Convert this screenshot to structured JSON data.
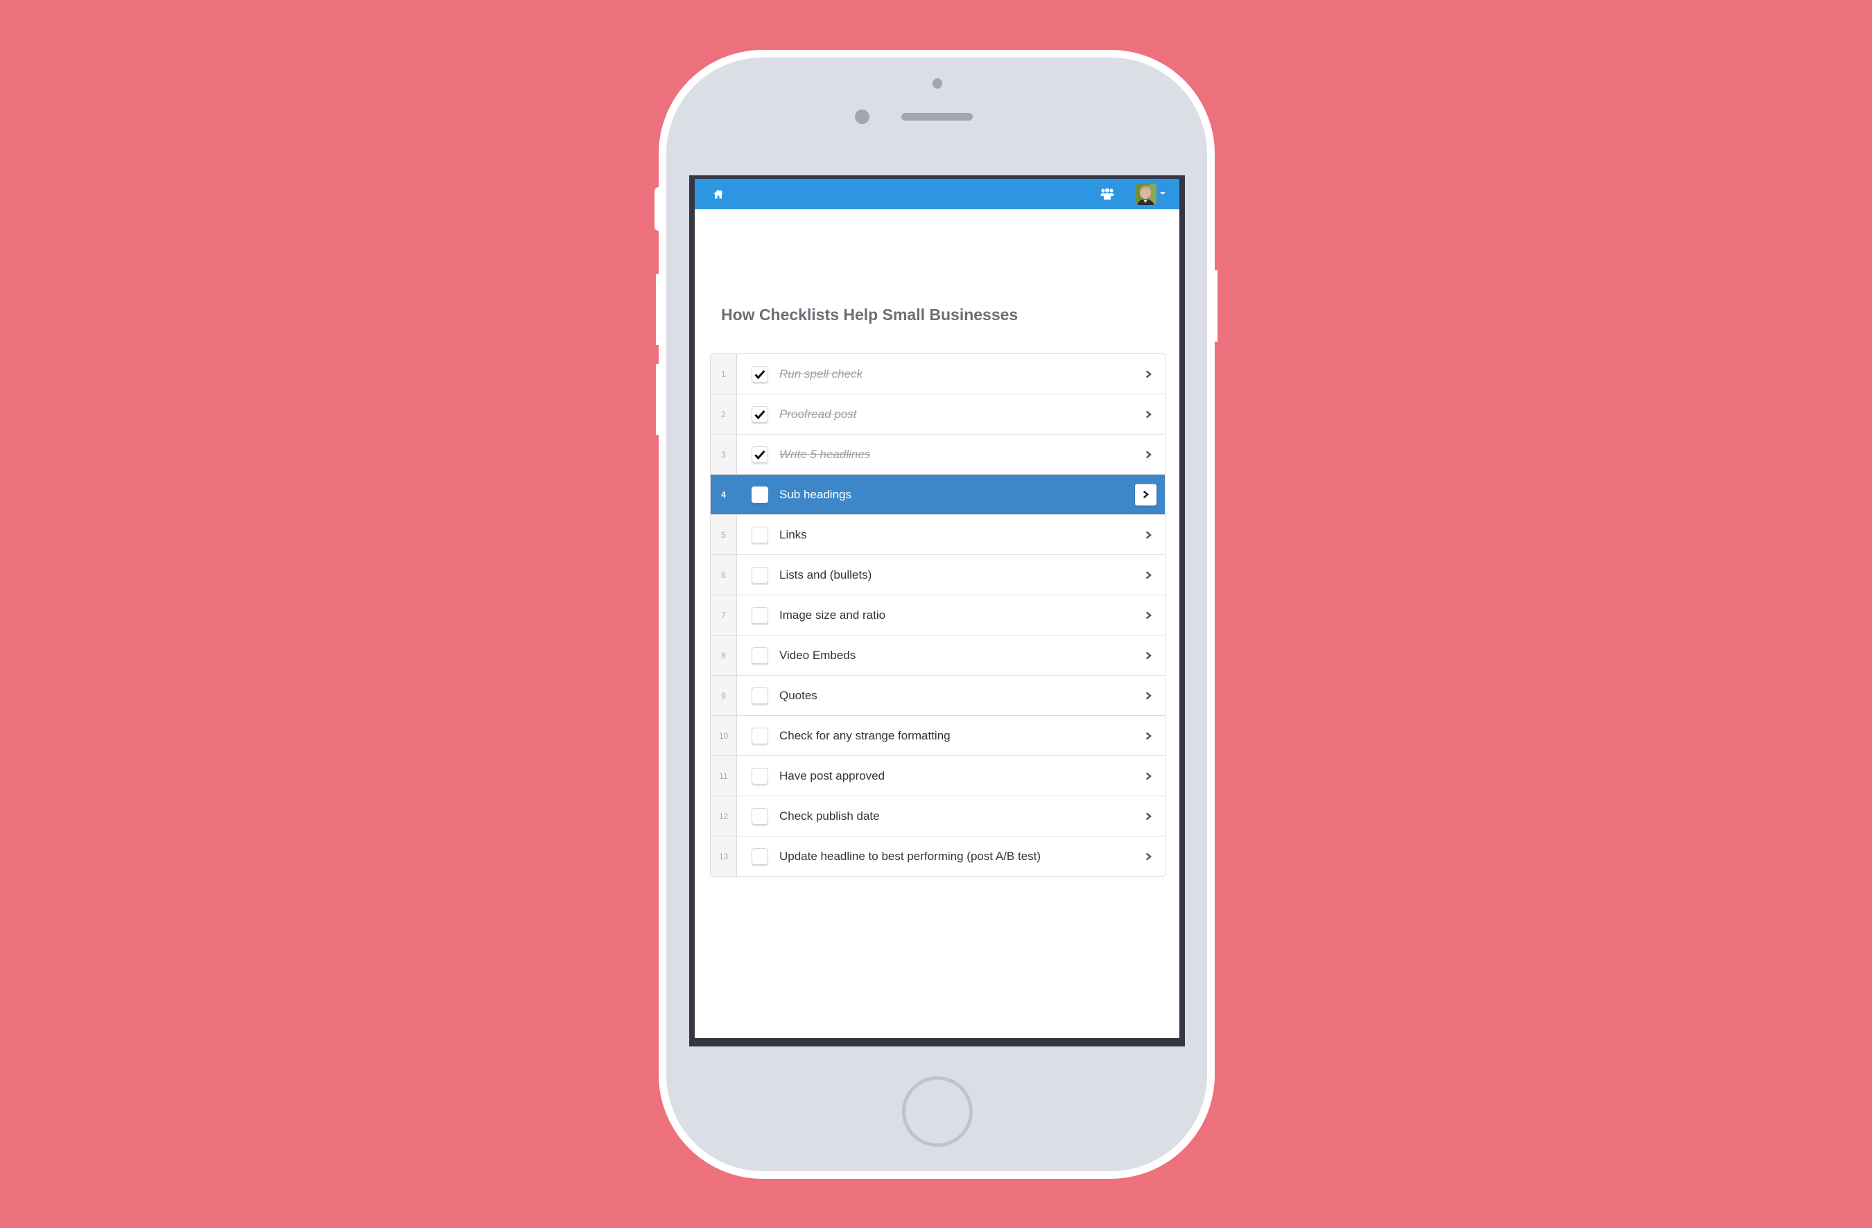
{
  "colors": {
    "background": "#ec717c",
    "navbar": "#2d96e2",
    "active_row": "#3d87c8",
    "phone_body": "#dbdee5",
    "screen_bezel": "#343741"
  },
  "navbar": {
    "home_icon": "home-icon",
    "team_icon": "users-icon",
    "avatar_icon": "user-avatar",
    "caret_icon": "caret-down-icon"
  },
  "checklist": {
    "title": "How Checklists Help Small Businesses",
    "active_index": 4,
    "items": [
      {
        "number": "1",
        "label": "Run spell check",
        "checked": true
      },
      {
        "number": "2",
        "label": "Proofread post",
        "checked": true
      },
      {
        "number": "3",
        "label": "Write 5 headlines",
        "checked": true
      },
      {
        "number": "4",
        "label": "Sub headings",
        "checked": false,
        "active": true
      },
      {
        "number": "5",
        "label": "Links",
        "checked": false
      },
      {
        "number": "6",
        "label": "Lists and (bullets)",
        "checked": false
      },
      {
        "number": "7",
        "label": "Image size and ratio",
        "checked": false
      },
      {
        "number": "8",
        "label": "Video Embeds",
        "checked": false
      },
      {
        "number": "9",
        "label": "Quotes",
        "checked": false
      },
      {
        "number": "10",
        "label": "Check for any strange formatting",
        "checked": false
      },
      {
        "number": "11",
        "label": "Have post approved",
        "checked": false
      },
      {
        "number": "12",
        "label": "Check publish date",
        "checked": false
      },
      {
        "number": "13",
        "label": "Update headline to best performing (post A/B test)",
        "checked": false
      }
    ]
  }
}
